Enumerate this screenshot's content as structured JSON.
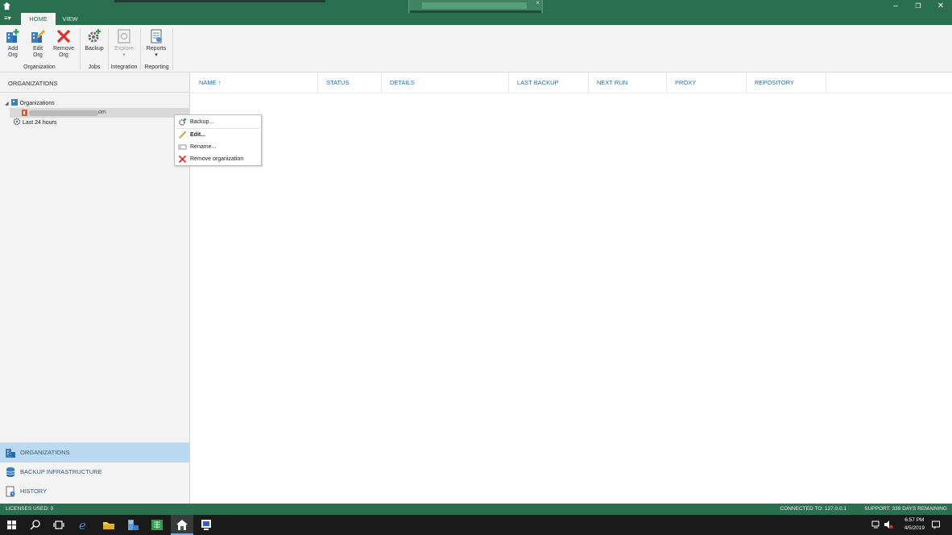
{
  "window": {
    "tabs": [
      {
        "label": "HOME"
      },
      {
        "label": "VIEW"
      }
    ],
    "menu_icon": "menu-icon",
    "controls": [
      "minimize-icon",
      "restore-icon",
      "close-icon"
    ]
  },
  "ribbon": {
    "buttons": [
      {
        "label": "Add\nOrg",
        "icon": "add-org-icon"
      },
      {
        "label": "Edit\nOrg",
        "icon": "edit-org-icon"
      },
      {
        "label": "Remove\nOrg",
        "icon": "remove-org-icon"
      },
      {
        "label": "Backup",
        "icon": "backup-gear-icon"
      },
      {
        "label": "Explore",
        "icon": "explore-icon",
        "dropdown": "▾"
      },
      {
        "label": "Reports",
        "icon": "reports-icon",
        "dropdown": "▾"
      }
    ],
    "groups": [
      "Organization",
      "Jobs",
      "Integration",
      "Reporting"
    ]
  },
  "sidebar": {
    "header": "ORGANIZATIONS",
    "tree": {
      "root_label": "Organizations",
      "child_suffix": "om",
      "last24_label": "Last 24 hours"
    },
    "nav": [
      {
        "label": "ORGANIZATIONS",
        "icon": "organizations-icon"
      },
      {
        "label": "BACKUP INFRASTRUCTURE",
        "icon": "database-icon"
      },
      {
        "label": "HISTORY",
        "icon": "history-icon"
      }
    ]
  },
  "grid": {
    "columns": [
      "NAME",
      "STATUS",
      "DETAILS",
      "LAST BACKUP",
      "NEXT RUN",
      "PROXY",
      "REPOSITORY"
    ],
    "sort_indicator": "↑"
  },
  "context_menu": {
    "items": [
      {
        "label": "Backup...",
        "icon": "backup-gear-icon"
      },
      {
        "label": "Edit...",
        "icon": "pencil-icon"
      },
      {
        "label": "Rename...",
        "icon": "rename-icon"
      },
      {
        "label": "Remove organization",
        "icon": "remove-icon"
      }
    ]
  },
  "statusbar": {
    "licenses": "LICENSES USED: 0",
    "connected": "CONNECTED TO: 127.0.0.1",
    "support": "SUPPORT: 339 DAYS REMAINING"
  },
  "taskbar": {
    "time": "6:57 PM",
    "date": "4/5/2019"
  },
  "colors": {
    "accent_green": "#2a7050",
    "link_blue": "#2a6aa8",
    "nav_active": "#bcd9f2",
    "remove_red": "#e0302c"
  }
}
